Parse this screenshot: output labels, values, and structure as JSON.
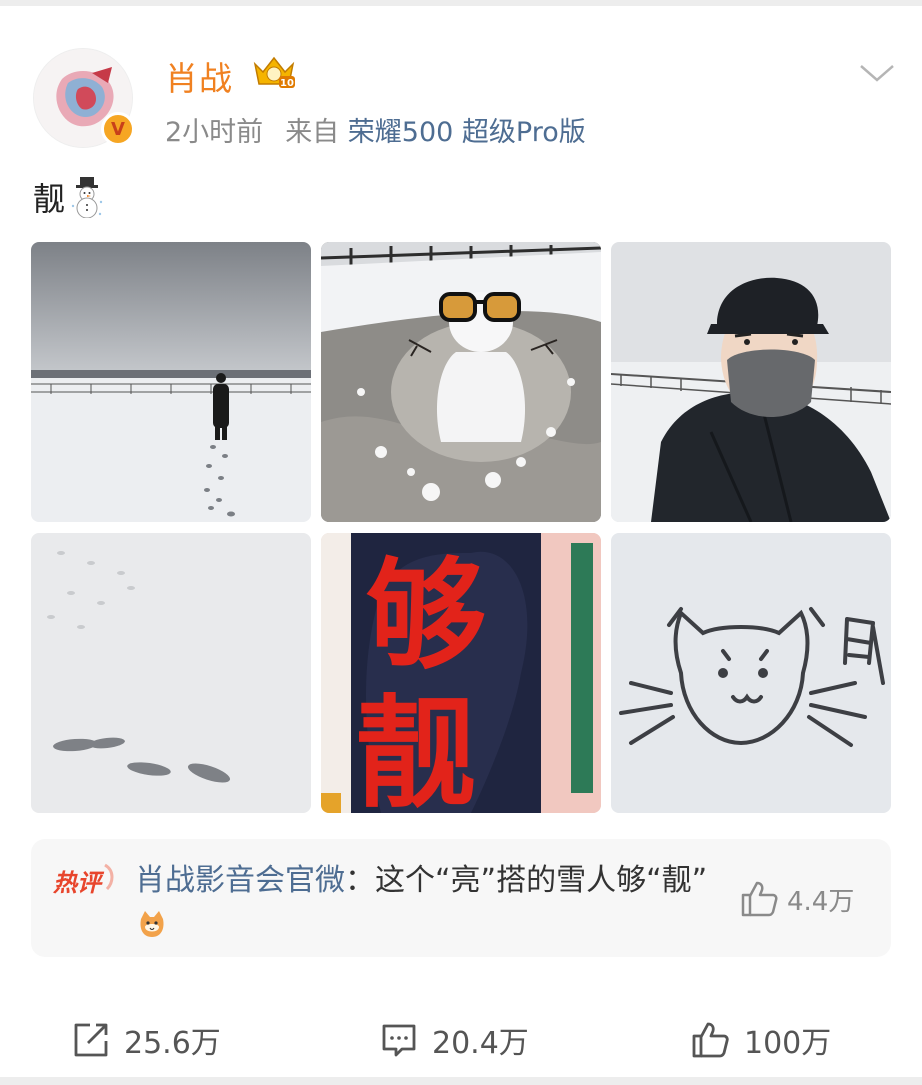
{
  "post": {
    "author": "肖战",
    "time": "2小时前",
    "from_label": "来自",
    "source": "荣耀500 超级Pro版",
    "text": "靓",
    "emoji_icon": "snowman-icon"
  },
  "images": [
    {
      "name": "snow-field-person-photo"
    },
    {
      "name": "snowman-sunglasses-photo"
    },
    {
      "name": "masked-selfie-photo"
    },
    {
      "name": "footprints-photo"
    },
    {
      "name": "red-characters-photo",
      "text_top": "够",
      "text_bottom": "靓"
    },
    {
      "name": "snow-cat-drawing-photo"
    }
  ],
  "hot_comment": {
    "badge": "热评",
    "author": "肖战影音会官微",
    "colon": "：",
    "text": "这个“亮”搭的雪人够“靓”",
    "like_count": "4.4万"
  },
  "actions": {
    "repost": "25.6万",
    "comment": "20.4万",
    "like": "100万"
  },
  "colors": {
    "username": "#f08121",
    "link": "#4e6d92",
    "meta": "#8a8a8a"
  }
}
